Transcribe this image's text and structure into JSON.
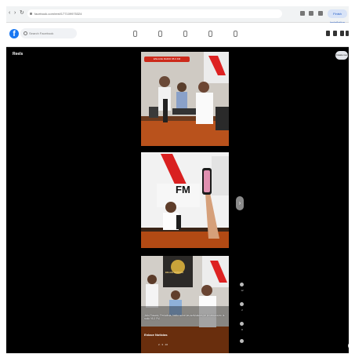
{
  "browser": {
    "url": "facebook.com/reel/177109975324",
    "finish_button": "Finish installation",
    "back_icon": "arrow-left-icon",
    "forward_icon": "arrow-right-icon",
    "reload_icon": "reload-icon"
  },
  "facebook": {
    "logo": "f",
    "search_placeholder": "Search Facebook",
    "nav_icons": [
      "home-icon",
      "video-icon",
      "marketplace-icon",
      "groups-icon",
      "gaming-icon"
    ],
    "right_icons": [
      "menu-icon",
      "messenger-icon",
      "bell-icon",
      "avatar-icon"
    ]
  },
  "reels": {
    "title": "Reels",
    "create_label": "Create reel",
    "items": [
      {
        "sticker": "ENLACE RADIO 95.3 FM"
      },
      {
        "sign": "FM"
      },
      {
        "caption": "Julio Rosario, Periodista, habla sobre las actividades de la semana en la radio 95.3 FM",
        "author": "Enlace Noticias",
        "stats": "2 · 3 · 16",
        "logo_text": "ENLACE NOTICIAS"
      }
    ],
    "side_counts": [
      "12",
      "2",
      "8"
    ],
    "next_label": "›",
    "help_label": "?"
  }
}
